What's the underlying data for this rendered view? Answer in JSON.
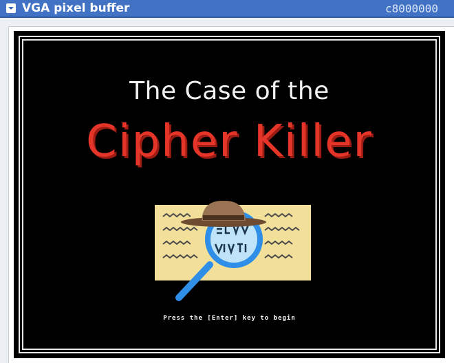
{
  "window": {
    "title": "VGA pixel buffer",
    "address": "c8000000",
    "collapse_icon": "chevron-down-icon"
  },
  "game": {
    "title_line1": "The Case of the",
    "title_line2": "Cipher Killer",
    "prompt": "Press the [Enter] key to begin",
    "artwork": "magnifying-glass-over-cipher-paper-with-detective-hat",
    "colors": {
      "background": "#000000",
      "frame": "#e8e8e8",
      "title_white": "#f2f2f2",
      "title_red": "#e53528",
      "paper": "#f1df9a",
      "lens": "#2f8fe8",
      "hat": "#8b6446"
    }
  }
}
